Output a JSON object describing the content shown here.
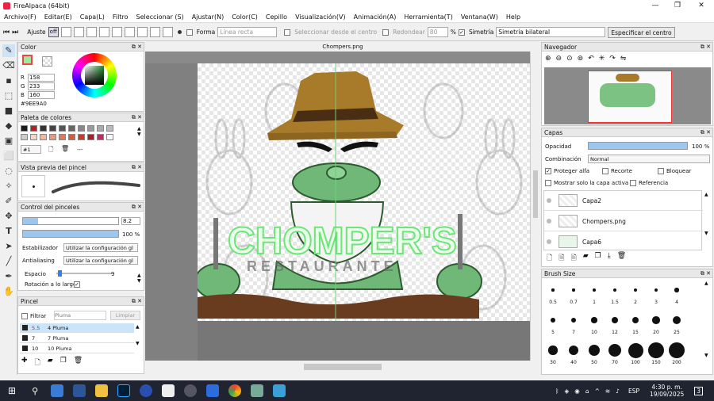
{
  "window": {
    "title": "FireAlpaca (64bit)"
  },
  "menu": [
    "Archivo(F)",
    "Editar(E)",
    "Capa(L)",
    "Filtro",
    "Seleccionar (S)",
    "Ajustar(N)",
    "Color(C)",
    "Cepillo",
    "Visualización(V)",
    "Animación(A)",
    "Herramienta(T)",
    "Ventana(W)",
    "Help"
  ],
  "toolbar": {
    "ajuste_label": "Ajuste",
    "ajuste_off": "off",
    "forma_label": "Forma",
    "forma_value": "Línea recta",
    "select_center_label": "Seleccionar desde el centro",
    "redondear_label": "Redondear",
    "redondear_value": "80",
    "percent": "%",
    "simetria_label": "Simetría",
    "simetria_value": "Simetría bilateral",
    "center_button": "Especificar el centro"
  },
  "color_panel": {
    "title": "Color",
    "r_label": "R",
    "r": "158",
    "g_label": "G",
    "g": "233",
    "b_label": "B",
    "b": "160",
    "hex": "#9EE9A0",
    "fg_color": "#9EE9A0"
  },
  "palette_panel": {
    "title": "Paleta de colores",
    "palette_select": "#1",
    "dashes": "---",
    "colors": [
      "#1a1a1a",
      "#b22222",
      "#333333",
      "#444444",
      "#555555",
      "#666666",
      "#888888",
      "#999999",
      "#aaaaaa",
      "#bbbbbb",
      "#cccccc",
      "#f3d6c4",
      "#f2b89a",
      "#e89a7c",
      "#e07a5a",
      "#d45c3c",
      "#c93c28",
      "#a8202a",
      "#c42a6a",
      "#ffffff"
    ]
  },
  "brush_preview": {
    "title": "Vista previa del pincel"
  },
  "brush_control": {
    "title": "Control del pinceles",
    "size_value": "8.2",
    "opacity_value": "100 %",
    "estabilizador_label": "Estabilizador",
    "estabilizador_value": "Utilizar la configuración gl",
    "antialiasing_label": "Antialiasing",
    "antialiasing_value": "Utilizar la configuración gl",
    "espacio_label": "Espacio",
    "espacio_value": "9",
    "rotacion_label": "Rotación a lo largo",
    "size_fraction": 0.16,
    "opacity_fraction": 1.0
  },
  "pincel_panel": {
    "title": "Pincel",
    "filtrar_label": "Filtrar",
    "search_placeholder": "Pluma",
    "clear_button": "Limpiar",
    "items": [
      {
        "size": "5.5",
        "name": "4 Pluma"
      },
      {
        "size": "7",
        "name": "7 Pluma"
      },
      {
        "size": "10",
        "name": "10 Pluma"
      }
    ]
  },
  "document": {
    "tab": "Chompers.png"
  },
  "artwork": {
    "title_text": "CHOMPER'S",
    "subtitle_text": "RESTAURANTE"
  },
  "navigator": {
    "title": "Navegador"
  },
  "layers_panel": {
    "title": "Capas",
    "opacidad_label": "Opacidad",
    "opacidad_value": "100 %",
    "opacity_fraction": 1.0,
    "combinacion_label": "Combinación",
    "combinacion_value": "Normal",
    "proteger_label": "Proteger alfa",
    "recorte_label": "Recorte",
    "bloquear_label": "Bloquear",
    "mostrar_label": "Mostrar solo la capa activa",
    "referencia_label": "Referencia",
    "layers": [
      "Capa2",
      "Chompers.png",
      "Capa6"
    ]
  },
  "brush_size": {
    "title": "Brush Size",
    "sizes": [
      "0.5",
      "0.7",
      "1",
      "1.5",
      "2",
      "3",
      "4",
      "5",
      "7",
      "10",
      "12",
      "15",
      "20",
      "25",
      "30",
      "40",
      "50",
      "70",
      "100",
      "150",
      "200"
    ]
  },
  "taskbar": {
    "time": "4:30 p. m.",
    "date": "19/09/2025",
    "lang": "ESP",
    "notif": "3"
  }
}
